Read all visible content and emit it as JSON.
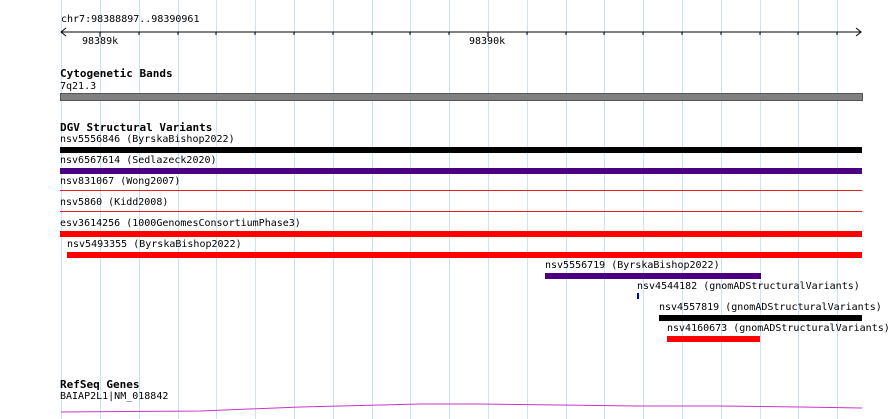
{
  "ruler": {
    "coordinates": "chr7:98388897..98390961",
    "ticks": [
      {
        "label": "98389k"
      },
      {
        "label": "98390k"
      }
    ]
  },
  "tracks": {
    "cytoband": {
      "title": "Cytogenetic Bands",
      "band_label": "7q21.3",
      "band_color": "#808080"
    },
    "dgv": {
      "title": "DGV Structural Variants",
      "features": [
        {
          "label": "nsv5556846 (ByrskaBishop2022)",
          "color": "#000000"
        },
        {
          "label": "nsv6567614 (Sedlazeck2020)",
          "color": "#4b0082"
        },
        {
          "label": "nsv831067 (Wong2007)",
          "color": "#dd2222"
        },
        {
          "label": "nsv5860 (Kidd2008)",
          "color": "#dd2222"
        },
        {
          "label": "esv3614256 (1000GenomesConsortiumPhase3)",
          "color": "#ff0000"
        },
        {
          "label": "nsv5493355 (ByrskaBishop2022)",
          "color": "#ff0000"
        },
        {
          "label": "nsv5556719 (ByrskaBishop2022)",
          "color": "#4b0082"
        },
        {
          "label": "nsv4544182 (gnomADStructuralVariants)",
          "color": "#0000cc"
        },
        {
          "label": "nsv4557819 (gnomADStructuralVariants)",
          "color": "#000000"
        },
        {
          "label": "nsv4160673 (gnomADStructuralVariants)",
          "color": "#ff0000"
        }
      ]
    },
    "refseq": {
      "title": "RefSeq Genes",
      "gene_label": "BAIAP2L1|NM_018842",
      "color": "#cc33cc"
    }
  }
}
